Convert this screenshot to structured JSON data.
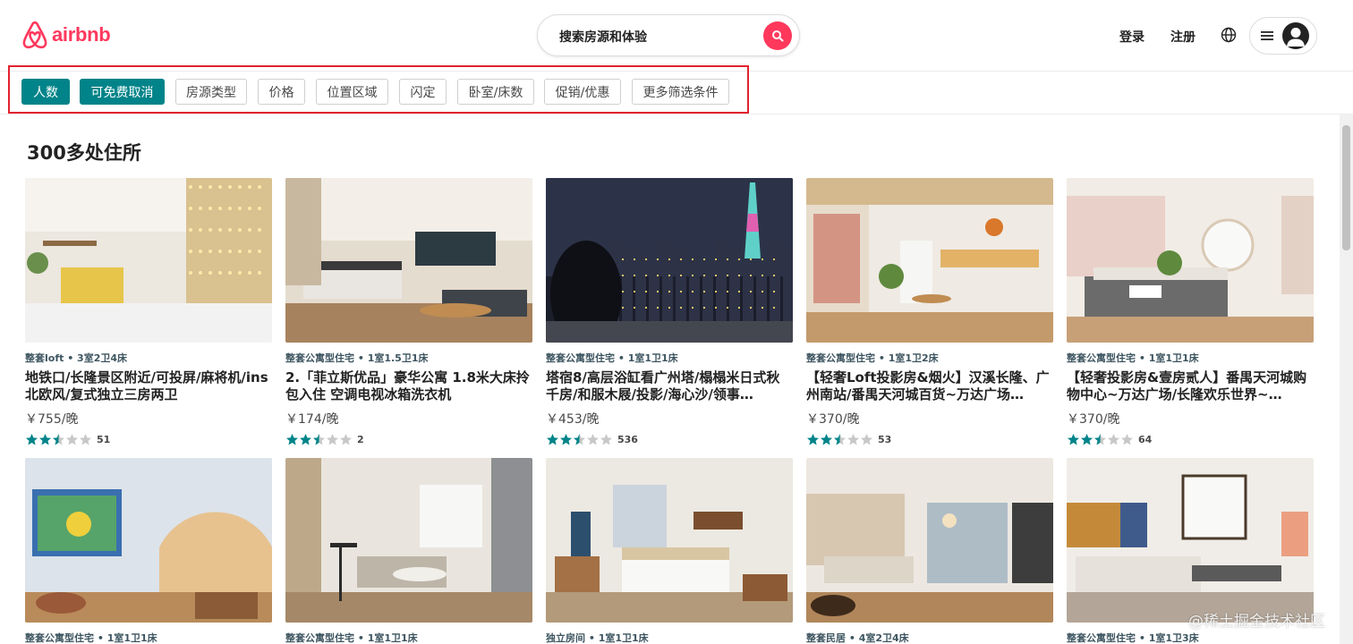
{
  "header": {
    "logo_text": "airbnb",
    "search_placeholder": "搜索房源和体验",
    "login": "登录",
    "register": "注册"
  },
  "filters": [
    {
      "label": "人数",
      "active": true
    },
    {
      "label": "可免费取消",
      "active": true
    },
    {
      "label": "房源类型",
      "active": false
    },
    {
      "label": "价格",
      "active": false
    },
    {
      "label": "位置区域",
      "active": false
    },
    {
      "label": "闪定",
      "active": false
    },
    {
      "label": "卧室/床数",
      "active": false
    },
    {
      "label": "促销/优惠",
      "active": false
    },
    {
      "label": "更多筛选条件",
      "active": false
    }
  ],
  "heading": "300多处住所",
  "colors": {
    "brand": "#ff385c",
    "teal": "#008489",
    "star": "#008489",
    "type_text": "#3d5560"
  },
  "listings": [
    {
      "type": "整套loft • 3室2卫4床",
      "title": "地铁口/长隆景区附近/可投屏/麻将机/ins北欧风/复式独立三房两卫",
      "price": "￥755/晚",
      "stars": 2.5,
      "reviews": "51"
    },
    {
      "type": "整套公寓型住宅 • 1室1.5卫1床",
      "title": "2.「菲立斯优品」豪华公寓 1.8米大床拎包入住 空调电视冰箱洗衣机",
      "price": "￥174/晚",
      "stars": 2.5,
      "reviews": "2"
    },
    {
      "type": "整套公寓型住宅 • 1室1卫1床",
      "title": "塔宿8/高层浴缸看广州塔/榻榻米日式秋千房/和服木屐/投影/海心沙/领事…",
      "price": "￥453/晚",
      "stars": 2.5,
      "reviews": "536"
    },
    {
      "type": "整套公寓型住宅 • 1室1卫2床",
      "title": "【轻奢Loft投影房&烟火】汉溪长隆、广州南站/番禺天河城百货~万达广场…",
      "price": "￥370/晚",
      "stars": 2.5,
      "reviews": "53"
    },
    {
      "type": "整套公寓型住宅 • 1室1卫1床",
      "title": "【轻奢投影房&壹房贰人】番禺天河城购物中心~万达广场/长隆欢乐世界~…",
      "price": "￥370/晚",
      "stars": 2.5,
      "reviews": "64"
    },
    {
      "type": "整套公寓型住宅 • 1室1卫1床"
    },
    {
      "type": "整套公寓型住宅 • 1室1卫1床"
    },
    {
      "type": "独立房间 • 1室1卫1床"
    },
    {
      "type": "整套民居 • 4室2卫4床"
    },
    {
      "type": "整套公寓型住宅 • 1室1卫3床"
    }
  ],
  "watermark": "@稀土掘金技术社区"
}
